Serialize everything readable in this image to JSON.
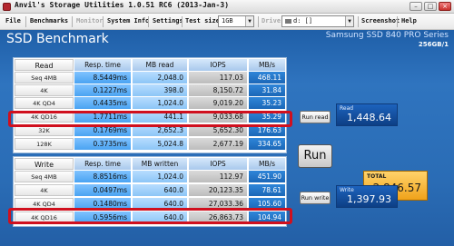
{
  "window": {
    "title": "Anvil's Storage Utilities 1.0.51 RC6 (2013-Jan-3)",
    "minimize": "–",
    "maximize": "□",
    "close": "×"
  },
  "menu": {
    "file": "File",
    "benchmarks": "Benchmarks",
    "monitor": "Monitor",
    "system_info": "System Info",
    "settings": "Settings",
    "test_size_label": "Test size",
    "test_size_value": "1GB",
    "drive_label": "Drive",
    "drive_value": "d: []",
    "screenshot": "Screenshot",
    "help": "Help"
  },
  "header": {
    "title": "SSD Benchmark",
    "model": "Samsung SSD 840 PRO Series",
    "capacity": "256GB/1"
  },
  "read_table": {
    "columns": [
      "Read",
      "Resp. time",
      "MB read",
      "IOPS",
      "MB/s"
    ],
    "rows": [
      [
        "Seq 4MB",
        "8.5449ms",
        "2,048.0",
        "117.03",
        "468.11"
      ],
      [
        "4K",
        "0.1227ms",
        "398.0",
        "8,150.72",
        "31.84"
      ],
      [
        "4K QD4",
        "0.4435ms",
        "1,024.0",
        "9,019.20",
        "35.23"
      ],
      [
        "4K QD16",
        "1.7711ms",
        "441.1",
        "9,033.68",
        "35.29"
      ],
      [
        "32K",
        "0.1769ms",
        "2,652.3",
        "5,652.30",
        "176.63"
      ],
      [
        "128K",
        "0.3735ms",
        "5,024.8",
        "2,677.19",
        "334.65"
      ]
    ]
  },
  "write_table": {
    "columns": [
      "Write",
      "Resp. time",
      "MB written",
      "IOPS",
      "MB/s"
    ],
    "rows": [
      [
        "Seq 4MB",
        "8.8516ms",
        "1,024.0",
        "112.97",
        "451.90"
      ],
      [
        "4K",
        "0.0497ms",
        "640.0",
        "20,123.35",
        "78.61"
      ],
      [
        "4K QD4",
        "0.1480ms",
        "640.0",
        "27,033.36",
        "105.60"
      ],
      [
        "4K QD16",
        "0.5956ms",
        "640.0",
        "26,863.73",
        "104.94"
      ]
    ]
  },
  "buttons": {
    "run_read": "Run read",
    "run": "Run",
    "run_write": "Run write"
  },
  "scores": {
    "read_label": "Read",
    "read_value": "1,448.64",
    "total_label": "TOTAL",
    "total_value": "2,846.57",
    "write_label": "Write",
    "write_value": "1,397.93"
  },
  "colors": {
    "panel_blue": "#2a6cb5",
    "highlight_red": "#d0101e",
    "total_orange": "#f0a21a"
  }
}
